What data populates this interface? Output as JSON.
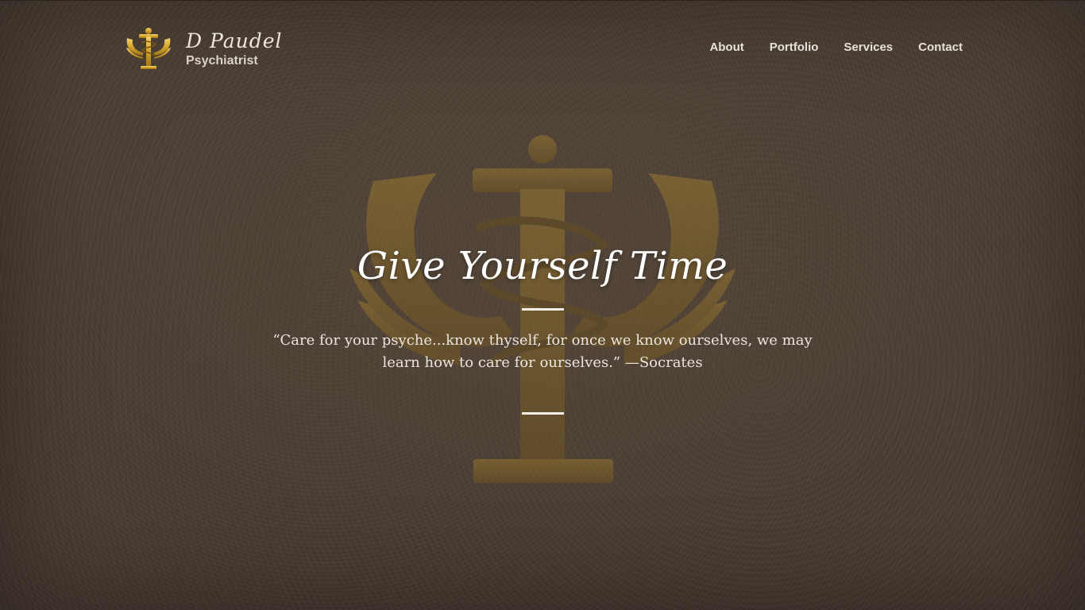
{
  "brand": {
    "name": "D Paudel",
    "tagline": "Psychiatrist",
    "logo_icon": "psi-caduceus-icon"
  },
  "nav": {
    "items": [
      {
        "label": "About"
      },
      {
        "label": "Portfolio"
      },
      {
        "label": "Services"
      },
      {
        "label": "Contact"
      }
    ]
  },
  "hero": {
    "title": "Give Yourself Time",
    "quote": "“Care for your psyche...know thyself, for once we know ourselves, we may learn how to care for ourselves.”  —Socrates",
    "background_icon": "psi-emblem-watermark-icon"
  },
  "colors": {
    "background": "#4a3d33",
    "gold": "#c9a227",
    "text": "#f3ede6"
  }
}
